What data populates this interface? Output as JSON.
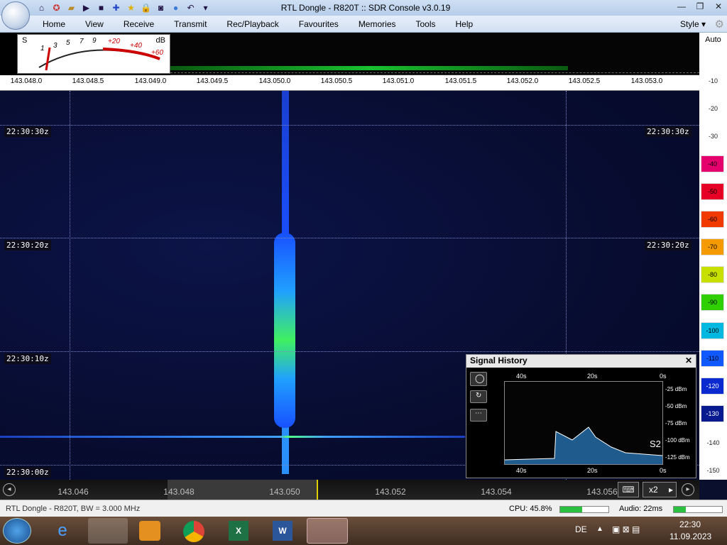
{
  "window": {
    "title": "RTL Dongle - R820T :: SDR Console v3.0.19",
    "controls": [
      "—",
      "❐",
      "✕"
    ]
  },
  "menu": [
    "Home",
    "View",
    "Receive",
    "Transmit",
    "Rec/Playback",
    "Favourites",
    "Memories",
    "Tools",
    "Help"
  ],
  "style_label": "Style",
  "smeter": {
    "s_label": "S",
    "db_label": "dB",
    "scale": [
      "1",
      "3",
      "5",
      "7",
      "9",
      "+20",
      "+40",
      "+60"
    ]
  },
  "db_axis": {
    "auto": "Auto",
    "ticks": [
      "-10",
      "-20",
      "-30",
      "-40",
      "-50",
      "-60",
      "-70",
      "-80",
      "-90",
      "-100",
      "-110",
      "-120",
      "-130",
      "-140",
      "-150"
    ]
  },
  "top_ruler": [
    "143.048.0",
    "143.048.5",
    "143.049.0",
    "143.049.5",
    "143.050.0",
    "143.050.5",
    "143.051.0",
    "143.051.5",
    "143.052.0",
    "143.052.5",
    "143.053.0"
  ],
  "time_labels": [
    "22:30:30z",
    "22:30:20z",
    "22:30:10z",
    "22:30:00z"
  ],
  "bottom_ruler": [
    "143.046",
    "143.048",
    "143.050",
    "143.052",
    "143.054",
    "143.056"
  ],
  "zoom_label": "x2",
  "signal_history": {
    "title": "Signal History",
    "x_ticks": [
      "40s",
      "20s",
      "0s"
    ],
    "y_ticks": [
      "-25 dBm",
      "-50 dBm",
      "-75 dBm",
      "-100 dBm",
      "-125 dBm"
    ],
    "s_reading": "S2"
  },
  "status": {
    "left": "RTL Dongle - R820T, BW = 3.000 MHz",
    "cpu": "CPU: 45.8%",
    "cpu_level": 0.46,
    "audio": "Audio: 22ms",
    "audio_level": 0.25
  },
  "taskbar": {
    "lang": "DE",
    "time": "22:30",
    "date": "11.09.2023"
  }
}
